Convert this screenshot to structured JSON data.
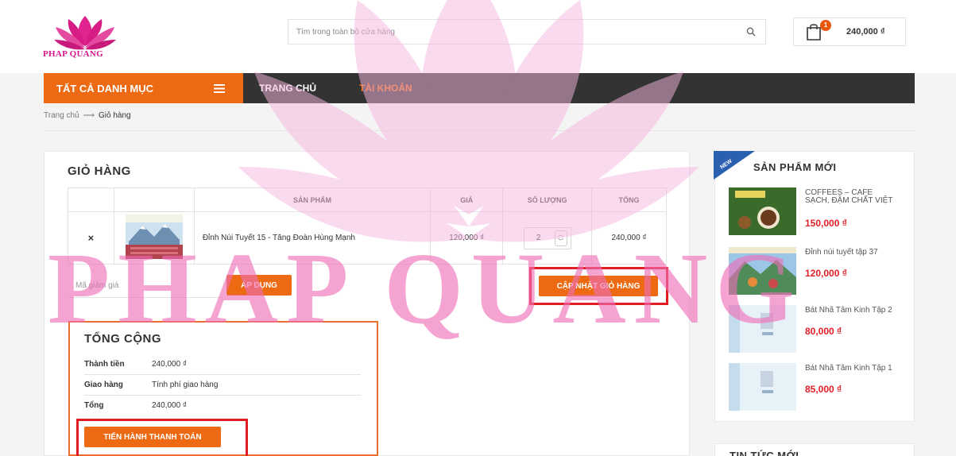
{
  "brand": {
    "logo_text": "PHAP QUANG",
    "watermark_text": "PHAP QUANG",
    "primary_color": "#ed6a12",
    "pink_color": "#e0238e",
    "price_color": "#e21e25"
  },
  "header": {
    "search_placeholder": "Tìm trong toàn bộ cửa hàng",
    "search_icon": "search-icon",
    "cart_icon": "shopping-bag-icon",
    "cart_count": "1",
    "cart_total": "240,000 ₫"
  },
  "nav": {
    "all_categories": "TẤT CẢ DANH MỤC",
    "menu_icon": "hamburger-icon",
    "links": [
      {
        "label": "TRANG CHỦ",
        "color": "#ffffff"
      },
      {
        "label": "TÀI KHOẢN",
        "color": "#ed6a12"
      }
    ]
  },
  "breadcrumb": {
    "home": "Trang chủ",
    "separator": "⟶",
    "current": "Giỏ hàng"
  },
  "cart": {
    "title": "GIỎ HÀNG",
    "columns": [
      "",
      "",
      "SẢN PHẨM",
      "GIÁ",
      "SỐ LƯỢNG",
      "TỔNG"
    ],
    "items": [
      {
        "remove": "×",
        "name": "Đỉnh Núi Tuyết 15 - Tăng Đoàn Hùng Mạnh",
        "price": "120,000 ₫",
        "quantity": "2",
        "total": "240,000 ₫"
      }
    ],
    "coupon_placeholder": "Mã giảm giá",
    "apply_label": "ÁP DỤNG",
    "update_label": "CẬP NHẬT GIỎ HÀNG"
  },
  "totals": {
    "title": "TỔNG CỘNG",
    "rows": [
      {
        "label": "Thành tiền",
        "value": "240,000 ₫"
      },
      {
        "label": "Giao hàng",
        "value": "Tính phí giao hàng"
      },
      {
        "label": "Tổng",
        "value": "240,000 ₫"
      }
    ],
    "checkout_label": "TIẾN HÀNH THANH TOÁN"
  },
  "sidebar": {
    "new_badge": "NEW",
    "new_products_title": "SẢN PHẨM MỚI",
    "products": [
      {
        "title": "COFFEES – CAFE SẠCH, ĐẬM CHẤT VIỆT",
        "price": "150,000 ₫"
      },
      {
        "title": "Đỉnh núi tuyết tập 37",
        "price": "120,000 ₫"
      },
      {
        "title": "Bát Nhã Tâm Kinh Tập 2",
        "price": "80,000 ₫"
      },
      {
        "title": "Bát Nhã Tâm Kinh Tập 1",
        "price": "85,000 ₫"
      }
    ],
    "news_title": "TIN TỨC MỚI"
  }
}
